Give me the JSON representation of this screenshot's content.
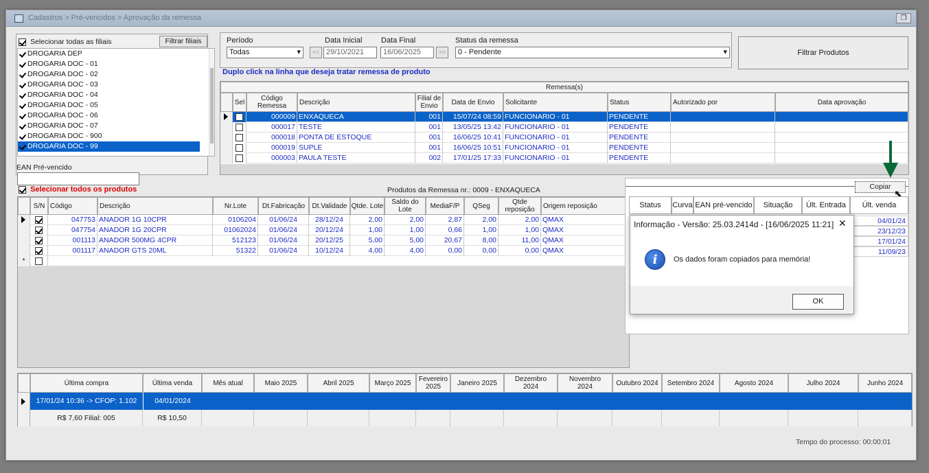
{
  "window": {
    "title": "Cadastros > Pré-vencidos > Aprovação da remessa"
  },
  "filiais": {
    "select_all_label": "Selecionar todas as filiais",
    "filter_button": "Filtrar filiais",
    "items": [
      "DROGARIA DEP",
      "DROGARIA DOC - 01",
      "DROGARIA DOC - 02",
      "DROGARIA DOC - 03",
      "DROGARIA DOC - 04",
      "DROGARIA DOC - 05",
      "DROGARIA DOC - 06",
      "DROGARIA DOC - 07",
      "DROGARIA DOC - 900",
      "DROGARIA DOC - 99"
    ],
    "ean_label": "EAN Pré-vencido",
    "ean_value": ""
  },
  "filters": {
    "periodo_label": "Período",
    "periodo_value": "Todas",
    "data_inicial_label": "Data Inicial",
    "data_inicial_value": "29/10/2021",
    "data_final_label": "Data Final",
    "data_final_value": "16/06/2025",
    "status_label": "Status da remessa",
    "status_value": "0 - Pendente",
    "prev_btn": "<<",
    "next_btn": ">>",
    "filter_products_button": "Filtrar Produtos"
  },
  "hint": "Duplo click na linha que deseja tratar remessa de produto",
  "remessas": {
    "group_title": "Remessa(s)",
    "headers": [
      "Sel",
      "Código Remessa",
      "Descrição",
      "Filial de Envio",
      "Data de Envio",
      "Solicitante",
      "Status",
      "Autorizado por",
      "Data aprovação"
    ],
    "rows": [
      [
        "000009",
        "ENXAQUECA",
        "001",
        "15/07/24 08:59",
        "FUNCIONARIO - 01",
        "PENDENTE"
      ],
      [
        "000017",
        "TESTE",
        "001",
        "13/05/25 13:42",
        "FUNCIONARIO - 01",
        "PENDENTE"
      ],
      [
        "000018",
        "PONTA DE ESTOQUE",
        "001",
        "16/06/25 10:41",
        "FUNCIONARIO - 01",
        "PENDENTE"
      ],
      [
        "000019",
        "SUPLE",
        "001",
        "16/06/25 10:51",
        "FUNCIONARIO - 01",
        "PENDENTE"
      ],
      [
        "000003",
        "PAULA TESTE",
        "002",
        "17/01/25 17:33",
        "FUNCIONARIO - 01",
        "PENDENTE"
      ]
    ]
  },
  "produtos": {
    "select_all_label": "Selecionar todos os produtos",
    "group_title": "Produtos da Remessa nr.: 0009 - ENXAQUECA",
    "headers": [
      "S/N",
      "Código",
      "Descrição",
      "Nr.Lote",
      "Dt.Fabricação",
      "Dt.Validade",
      "Qtde. Lote",
      "Saldo do Lote",
      "MediaF/P",
      "QSeg",
      "Qtde reposição",
      "Origem reposição"
    ],
    "rows": [
      [
        "047753",
        "ANADOR 1G 10CPR",
        "0106204",
        "01/06/24",
        "28/12/24",
        "2,00",
        "2,00",
        "2,87",
        "2,00",
        "2,00",
        "QMAX"
      ],
      [
        "047754",
        "ANADOR 1G 20CPR",
        "01062024",
        "01/06/24",
        "20/12/24",
        "1,00",
        "1,00",
        "0,66",
        "1,00",
        "1,00",
        "QMAX"
      ],
      [
        "001113",
        "ANADOR 500MG 4CPR",
        "512123",
        "01/06/24",
        "20/12/25",
        "5,00",
        "5,00",
        "20,67",
        "8,00",
        "11,00",
        "QMAX"
      ],
      [
        "001117",
        "ANADOR GTS 20ML",
        "51322",
        "01/06/24",
        "10/12/24",
        "4,00",
        "4,00",
        "0,00",
        "0,00",
        "0,00",
        "QMAX"
      ]
    ]
  },
  "overlay": {
    "copy_button": "Copiar",
    "headers": [
      "Status",
      "Curva",
      "EAN pré-vencido",
      "Situação",
      "Últ. Entrada",
      "Últ. venda"
    ],
    "ult_venda": [
      "04/01/24",
      "23/12/23",
      "17/01/24",
      "11/09/23"
    ]
  },
  "dialog": {
    "title": "Informação - Versão: 25.03.2414d - [16/06/2025 11:21]",
    "message": "Os dados foram copiados para memória!",
    "ok": "OK",
    "close": "✕"
  },
  "history": {
    "headers": [
      "Última compra",
      "Última venda",
      "Mês atual",
      "Maio 2025",
      "Abril 2025",
      "Março 2025",
      "Fevereiro 2025",
      "Janeiro 2025",
      "Dezembro 2024",
      "Novembro 2024",
      "Outubro 2024",
      "Setembro 2024",
      "Agosto 2024",
      "Julho 2024",
      "Junho 2024"
    ],
    "row1": {
      "ultima_compra": "17/01/24 10:36 -> CFOP: 1.102",
      "ultima_venda": "04/01/2024"
    },
    "row2": {
      "ultima_compra": "R$ 7,60 Filial: 005",
      "ultima_venda": "R$ 10,50"
    }
  },
  "footer": {
    "tempo": "Tempo do processo: 00:00:01"
  },
  "colors": {
    "selection": "#0b62c9",
    "text_blue": "#1d2cc4",
    "red": "#e00000",
    "arrow": "#0a6b3a"
  }
}
